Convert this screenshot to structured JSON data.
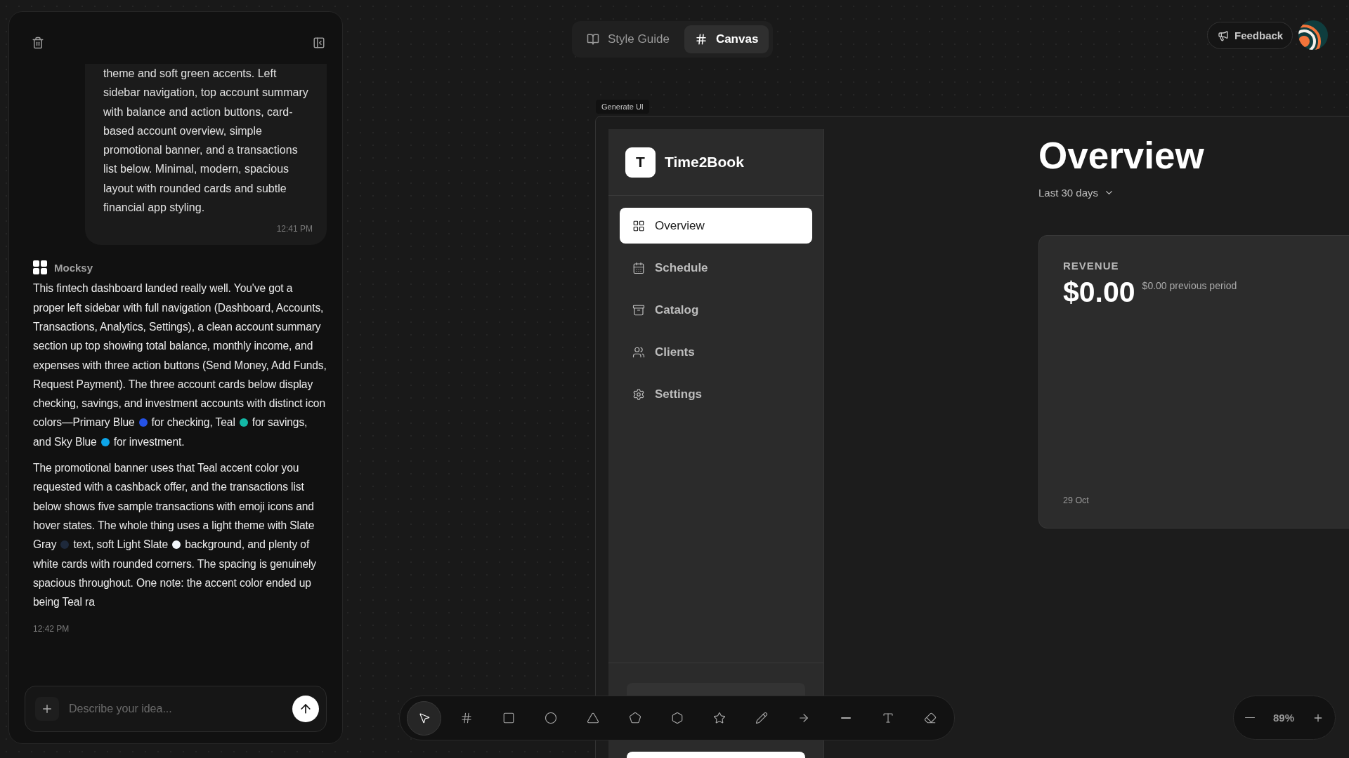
{
  "chat": {
    "user_message": {
      "text": "theme and soft green accents. Left sidebar navigation, top account summary with balance and action buttons, card-based account overview, simple promotional banner, and a transactions list below. Minimal, modern, spacious layout with rounded cards and subtle financial app styling.",
      "time": "12:41 PM"
    },
    "assistant": {
      "name": "Mocksy",
      "time": "12:42 PM",
      "paragraphs": [
        [
          {
            "text": "This fintech dashboard landed really well. You've got a proper left sidebar with full navigation (Dashboard, Accounts, Transactions, Analytics, Settings), a clean account summary section up top showing total balance, monthly income, and expenses with three action buttons (Send Money, Add Funds, Request Payment). The three account cards below display checking, savings, and investment accounts with distinct icon colors—Primary Blue"
          },
          {
            "color": "#2552e6"
          },
          {
            "text": "for checking, Teal"
          },
          {
            "color": "#14b8a6"
          },
          {
            "text": "for savings, and Sky Blue"
          },
          {
            "color": "#0ea5e9"
          },
          {
            "text": "for investment."
          }
        ],
        [
          {
            "text": "The promotional banner uses that Teal accent color you requested with a cashback offer, and the transactions list below shows five sample transactions with emoji icons and hover states. The whole thing uses a light theme with Slate Gray"
          },
          {
            "color": "#1e293b"
          },
          {
            "text": "text, soft Light Slate"
          },
          {
            "color": "#f1f5f9"
          },
          {
            "text": "background, and plenty of white cards with rounded corners. The spacing is genuinely spacious throughout. One note: the accent color ended up being Teal ra"
          }
        ]
      ]
    },
    "composer": {
      "placeholder": "Describe your idea..."
    }
  },
  "view_tabs": [
    {
      "label": "Style Guide",
      "selected": false
    },
    {
      "label": "Canvas",
      "selected": true
    }
  ],
  "feedback_button": {
    "label": "Feedback"
  },
  "canvas": {
    "frame_label": "Generate UI",
    "app": {
      "brand": {
        "letter": "T",
        "name": "Time2Book"
      },
      "nav": [
        {
          "label": "Overview",
          "selected": true
        },
        {
          "label": "Schedule",
          "selected": false
        },
        {
          "label": "Catalog",
          "selected": false
        },
        {
          "label": "Clients",
          "selected": false
        },
        {
          "label": "Settings",
          "selected": false
        }
      ],
      "title": "Overview",
      "range": "Last 30 days",
      "card": {
        "label": "REVENUE",
        "value": "$0.00",
        "previous": "$0.00 previous period",
        "date": "29 Oct"
      }
    }
  },
  "toolbar": {
    "tools": [
      {
        "selected": true
      },
      {
        "selected": false
      },
      {
        "selected": false
      },
      {
        "selected": false
      },
      {
        "selected": false
      },
      {
        "selected": false
      },
      {
        "selected": false
      },
      {
        "selected": false
      },
      {
        "selected": false
      },
      {
        "selected": false
      },
      {
        "selected": false
      },
      {
        "selected": false
      },
      {
        "selected": false
      }
    ]
  },
  "zoom": {
    "level_text": "89%"
  }
}
